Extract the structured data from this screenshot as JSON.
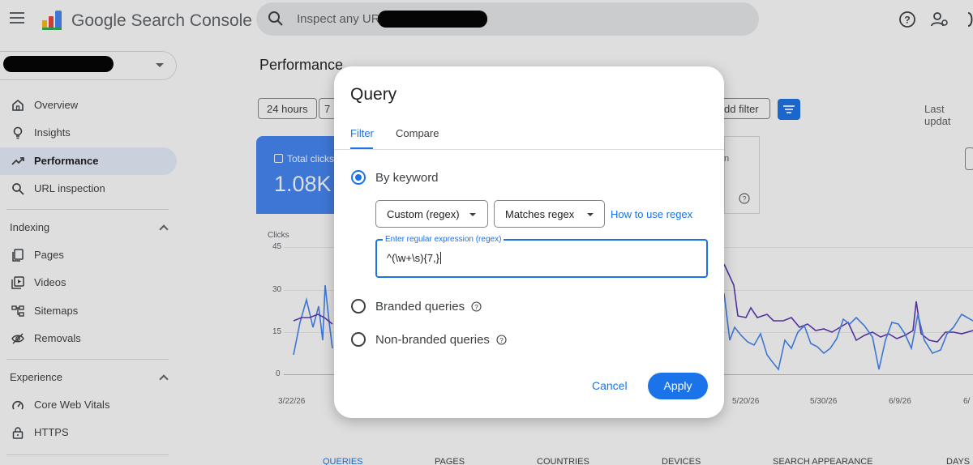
{
  "header": {
    "product_name": "Google Search Console",
    "search_placeholder": "Inspect any URL",
    "icons": [
      "menu-icon",
      "help-icon",
      "manage-users-icon",
      "apps-icon"
    ]
  },
  "sidebar": {
    "items": [
      {
        "label": "Overview",
        "icon": "home-icon"
      },
      {
        "label": "Insights",
        "icon": "lightbulb-icon"
      },
      {
        "label": "Performance",
        "icon": "trending-icon",
        "active": true
      },
      {
        "label": "URL inspection",
        "icon": "search-icon"
      }
    ],
    "sections": [
      {
        "title": "Indexing",
        "items": [
          {
            "label": "Pages",
            "icon": "pages-icon"
          },
          {
            "label": "Videos",
            "icon": "video-icon"
          },
          {
            "label": "Sitemaps",
            "icon": "sitemap-icon"
          },
          {
            "label": "Removals",
            "icon": "removals-icon"
          }
        ]
      },
      {
        "title": "Experience",
        "items": [
          {
            "label": "Core Web Vitals",
            "icon": "gauge-icon"
          },
          {
            "label": "HTTPS",
            "icon": "lock-icon"
          }
        ]
      }
    ]
  },
  "main": {
    "title": "Performance",
    "date_chips": [
      "24 hours",
      "7"
    ],
    "add_filter": "dd filter",
    "last_update": "Last updat",
    "total_clicks_label": "Total clicks",
    "total_clicks_value": "1.08K",
    "card_partial": "n",
    "chart": {
      "y_label": "Clicks",
      "y_ticks": [
        "45",
        "30",
        "15",
        "0"
      ],
      "x_ticks": [
        "3/22/26",
        "5/20/26",
        "5/30/26",
        "6/9/26",
        "6/"
      ]
    },
    "bottom_tabs": [
      "QUERIES",
      "PAGES",
      "COUNTRIES",
      "DEVICES",
      "SEARCH APPEARANCE",
      "DAYS"
    ]
  },
  "dialog": {
    "title": "Query",
    "tabs": [
      "Filter",
      "Compare"
    ],
    "options": {
      "by_keyword": "By keyword",
      "branded": "Branded queries",
      "non_branded": "Non-branded queries"
    },
    "selected_option": "by_keyword",
    "filter_type": "Custom (regex)",
    "match_type": "Matches regex",
    "regex_help_link": "How to use regex",
    "regex_label": "Enter regular expression (regex)",
    "regex_value": "^(\\w+\\s){7,}",
    "cancel": "Cancel",
    "apply": "Apply"
  },
  "colors": {
    "accent": "#1a73e8",
    "clicks_series": "#4285f4",
    "impressions_series": "#5e35b1",
    "active_nav_bg": "#e8f0fe"
  }
}
